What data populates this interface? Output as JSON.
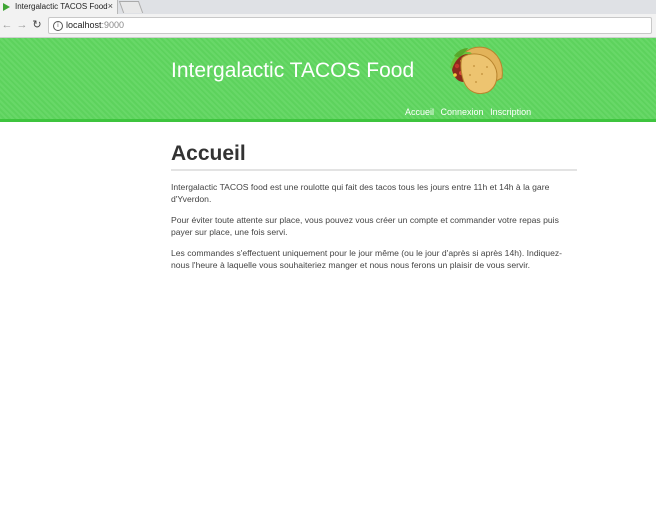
{
  "browser": {
    "tab_title": "Intergalactic TACOS Food",
    "tab_close": "×",
    "url_host": "localhost",
    "url_port": ":9000"
  },
  "header": {
    "site_title": "Intergalactic TACOS Food",
    "logo_icon": "taco-icon",
    "nav": [
      {
        "label": "Accueil"
      },
      {
        "label": "Connexion"
      },
      {
        "label": "Inscription"
      }
    ],
    "background_color": "#5fd65f"
  },
  "main": {
    "title": "Accueil",
    "paragraphs": [
      "Intergalactic TACOS food est une roulotte qui fait des tacos tous les jours entre 11h et 14h à la gare d'Yverdon.",
      "Pour éviter toute attente sur place, vous pouvez vous créer un compte et commander votre repas puis payer sur place, une fois servi.",
      "Les commandes s'effectuent uniquement pour le jour même (ou le jour d'après si après 14h). Indiquez-nous l'heure à laquelle vous souhaiteriez manger et nous nous ferons un plaisir de vous servir."
    ]
  }
}
